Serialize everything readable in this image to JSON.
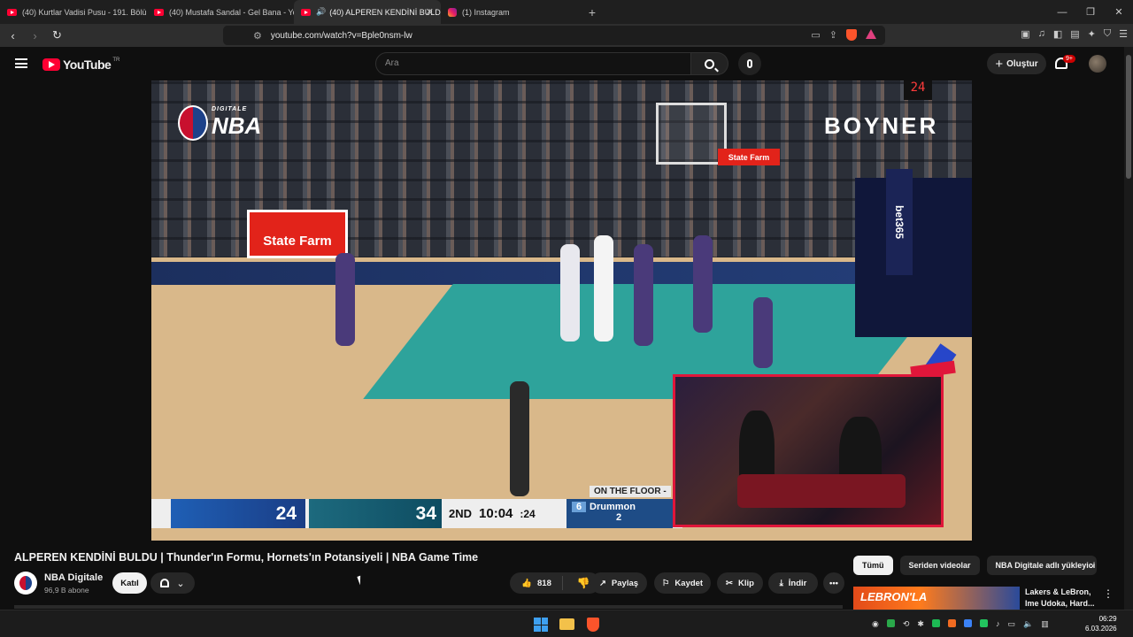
{
  "browser": {
    "tabs": [
      {
        "title": "(40) Kurtlar Vadisi Pusu - 191. Bölüm",
        "icon": "youtube-icon",
        "active": false
      },
      {
        "title": "(40) Mustafa Sandal - Gel Bana - You",
        "icon": "youtube-icon",
        "active": false
      },
      {
        "title": "(40) ALPEREN KENDİNİ BULD",
        "icon": "youtube-icon",
        "active": true
      },
      {
        "title": "(1) Instagram",
        "icon": "instagram-icon",
        "active": false
      }
    ],
    "url": "youtube.com/watch?v=Bple0nsm-lw",
    "accent": "#ff0033"
  },
  "youtube": {
    "logo_text": "YouTube",
    "region": "TR",
    "search_placeholder": "Ara",
    "create_label": "Oluştur",
    "notification_count": "9+"
  },
  "video": {
    "watermark": "NBA",
    "watermark_sub": "DIGITALE",
    "sponsor": "BOYNER",
    "ad_statefarm": "State Farm",
    "ad_bet365": "bet365",
    "shot_clock": "24",
    "score_home": "24",
    "score_away": "34",
    "quarter": "2ND",
    "game_clock": "10:04",
    "shot": ":24",
    "on_floor_label": "ON THE FLOOR -",
    "player_number": "6",
    "player_name": "Drummon",
    "player_stat": "2"
  },
  "meta": {
    "title": "ALPEREN KENDİNİ BULDU | Thunder'ın Formu, Hornets'ın Potansiyeli | NBA Game Time",
    "channel": "NBA Digitale",
    "subscribers": "96,9 B abone",
    "join_label": "Katıl",
    "likes": "818",
    "share_label": "Paylaş",
    "save_label": "Kaydet",
    "clip_label": "Klip",
    "download_label": "İndir"
  },
  "related": {
    "chips": [
      "Tümü",
      "Seriden videolar",
      "NBA Digitale adlı yükleyici"
    ],
    "first_thumb_text": "LEBRON'LA",
    "first_title": "Lakers & LeBron, Ime Udoka, Hard..."
  },
  "taskbar": {
    "time": "06:29",
    "date": "6.03.2026"
  }
}
